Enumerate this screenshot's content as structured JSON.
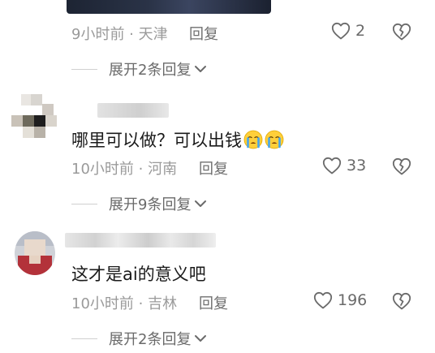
{
  "comment_top": {
    "time": "9小时前",
    "location": "天津",
    "reply_label": "回复",
    "likes": "2",
    "expand_label": "展开2条回复"
  },
  "comment_2": {
    "text": "哪里可以做？可以出钱",
    "time": "10小时前",
    "location": "河南",
    "reply_label": "回复",
    "likes": "33",
    "expand_label": "展开9条回复"
  },
  "comment_3": {
    "text": "这才是ai的意义吧",
    "time": "10小时前",
    "location": "吉林",
    "reply_label": "回复",
    "likes": "196",
    "expand_label": "展开2条回复"
  },
  "meta_separator": " · "
}
